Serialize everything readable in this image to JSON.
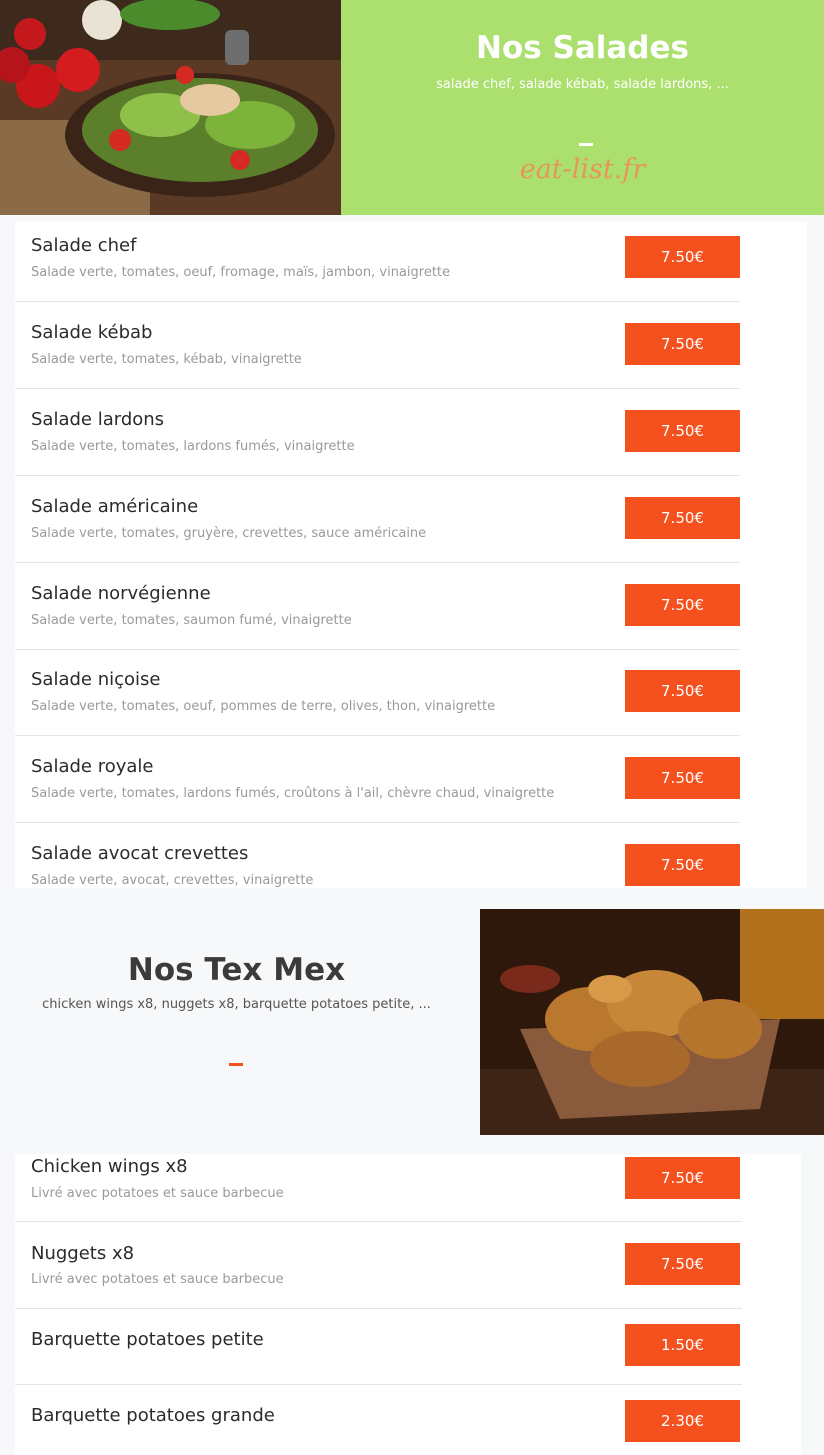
{
  "salads": {
    "title": "Nos Salades",
    "subtitle": "salade chef, salade kébab, salade lardons, ...",
    "watermark": "eat-list.fr",
    "items": [
      {
        "name": "Salade chef",
        "desc": "Salade verte, tomates, oeuf, fromage, maïs, jambon, vinaigrette",
        "price": "7.50€"
      },
      {
        "name": "Salade kébab",
        "desc": "Salade verte, tomates, kébab, vinaigrette",
        "price": "7.50€"
      },
      {
        "name": "Salade lardons",
        "desc": "Salade verte, tomates, lardons fumés, vinaigrette",
        "price": "7.50€"
      },
      {
        "name": "Salade américaine",
        "desc": "Salade verte, tomates, gruyère, crevettes, sauce américaine",
        "price": "7.50€"
      },
      {
        "name": "Salade norvégienne",
        "desc": "Salade verte, tomates, saumon fumé, vinaigrette",
        "price": "7.50€"
      },
      {
        "name": "Salade niçoise",
        "desc": "Salade verte, tomates, oeuf, pommes de terre, olives, thon, vinaigrette",
        "price": "7.50€"
      },
      {
        "name": "Salade royale",
        "desc": "Salade verte, tomates, lardons fumés, croûtons à l'ail, chèvre chaud, vinaigrette",
        "price": "7.50€"
      },
      {
        "name": "Salade avocat crevettes",
        "desc": "Salade verte, avocat, crevettes, vinaigrette",
        "price": "7.50€"
      }
    ]
  },
  "texmex": {
    "title": "Nos Tex Mex",
    "subtitle": "chicken wings x8, nuggets x8, barquette potatoes petite, ...",
    "items": [
      {
        "name": "Chicken wings x8",
        "desc": "Livré avec potatoes et sauce barbecue",
        "price": "7.50€"
      },
      {
        "name": "Nuggets x8",
        "desc": "Livré avec potatoes et sauce barbecue",
        "price": "7.50€"
      },
      {
        "name": "Barquette potatoes petite",
        "desc": "",
        "price": "1.50€"
      },
      {
        "name": "Barquette potatoes grande",
        "desc": "",
        "price": "2.30€"
      }
    ]
  },
  "colors": {
    "accent": "#f4511e",
    "salad_banner": "#abe06e",
    "watermark": "#e8955c"
  }
}
